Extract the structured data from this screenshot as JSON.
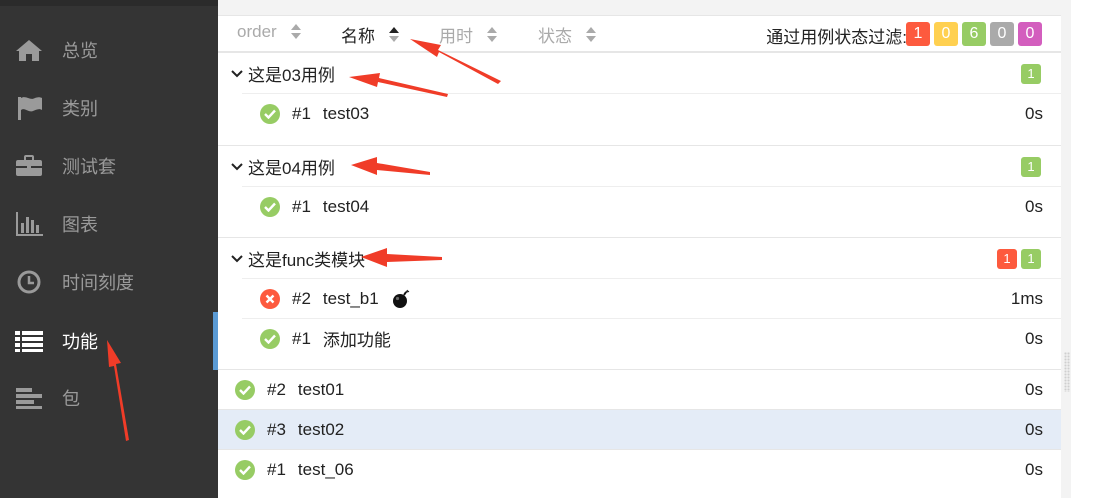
{
  "sidebar": {
    "items": [
      {
        "label": "总览",
        "icon": "home-icon"
      },
      {
        "label": "类别",
        "icon": "flag-icon"
      },
      {
        "label": "测试套",
        "icon": "briefcase-icon"
      },
      {
        "label": "图表",
        "icon": "bar-chart-icon"
      },
      {
        "label": "时间刻度",
        "icon": "clock-icon"
      },
      {
        "label": "功能",
        "icon": "list-icon"
      },
      {
        "label": "包",
        "icon": "align-left-icon"
      }
    ],
    "active_index": 5
  },
  "toolbar": {
    "sort_order": "order",
    "sort_name": "名称",
    "sort_duration": "用时",
    "sort_status": "状态",
    "filter_label": "通过用例状态过滤:",
    "filter_counts": [
      {
        "value": "1",
        "color": "#fd5a3e",
        "status": "failed"
      },
      {
        "value": "0",
        "color": "#ffd050",
        "status": "broken"
      },
      {
        "value": "6",
        "color": "#97cc64",
        "status": "passed"
      },
      {
        "value": "0",
        "color": "#aaaaaa",
        "status": "skipped"
      },
      {
        "value": "0",
        "color": "#d35ebe",
        "status": "unknown"
      }
    ]
  },
  "groups": [
    {
      "title": "这是03用例",
      "counts": [
        {
          "value": "1",
          "color": "#97cc64"
        }
      ],
      "cases": [
        {
          "num": "#1",
          "name": "test03",
          "duration": "0s",
          "status": "passed"
        }
      ]
    },
    {
      "title": "这是04用例",
      "counts": [
        {
          "value": "1",
          "color": "#97cc64"
        }
      ],
      "cases": [
        {
          "num": "#1",
          "name": "test04",
          "duration": "0s",
          "status": "passed"
        }
      ]
    },
    {
      "title": "这是func类模块",
      "counts": [
        {
          "value": "1",
          "color": "#fd5a3e"
        },
        {
          "value": "1",
          "color": "#97cc64"
        }
      ],
      "cases": [
        {
          "num": "#2",
          "name": "test_b1",
          "duration": "1ms",
          "status": "failed",
          "flaky": true
        },
        {
          "num": "#1",
          "name": "添加功能",
          "duration": "0s",
          "status": "passed"
        }
      ]
    }
  ],
  "cases": [
    {
      "num": "#2",
      "name": "test01",
      "duration": "0s",
      "status": "passed"
    },
    {
      "num": "#3",
      "name": "test02",
      "duration": "0s",
      "status": "passed",
      "selected": true
    },
    {
      "num": "#1",
      "name": "test_06",
      "duration": "0s",
      "status": "passed"
    }
  ],
  "colors": {
    "sidebar_bg": "#343434",
    "active_bar": "#5b9bd5",
    "passed": "#97cc64",
    "failed": "#fd5a3e",
    "selected_row": "#e4ecf7",
    "annotation": "#f03c28"
  }
}
